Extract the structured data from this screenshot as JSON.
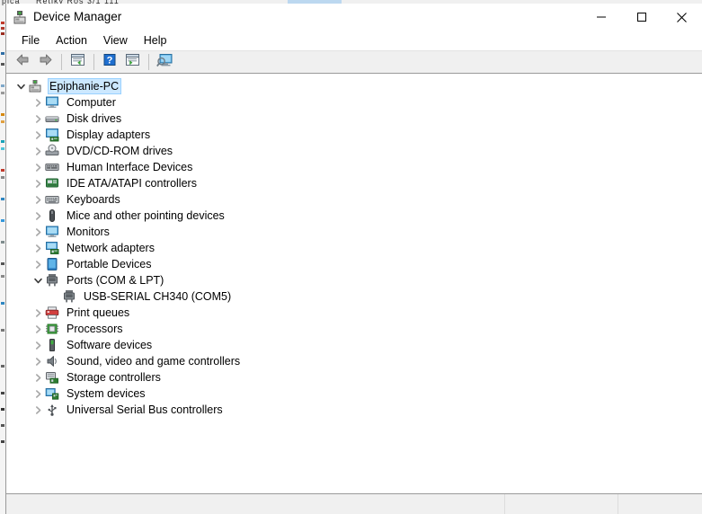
{
  "window": {
    "title": "Device Manager",
    "app_icon": "device-manager-icon",
    "controls": {
      "minimize": "–",
      "maximize": "□",
      "close": "✕"
    }
  },
  "menubar": {
    "items": [
      {
        "label": "File"
      },
      {
        "label": "Action"
      },
      {
        "label": "View"
      },
      {
        "label": "Help"
      }
    ]
  },
  "toolbar": {
    "buttons": [
      {
        "name": "back-button",
        "icon": "left-arrow-icon"
      },
      {
        "name": "forward-button",
        "icon": "right-arrow-icon"
      },
      {
        "name": "properties-button",
        "icon": "properties-icon"
      },
      {
        "name": "help-button",
        "icon": "question-mark-icon"
      },
      {
        "name": "update-driver-button",
        "icon": "play-window-icon"
      },
      {
        "name": "scan-hardware-changes-button",
        "icon": "monitor-search-icon"
      }
    ]
  },
  "tree": {
    "nodes": [
      {
        "label": "Epiphanie-PC",
        "level": 0,
        "expanded": true,
        "selected": true,
        "icon": "computer-root-icon",
        "has_children": true
      },
      {
        "label": "Computer",
        "level": 1,
        "expanded": false,
        "selected": false,
        "icon": "monitor-icon",
        "has_children": true
      },
      {
        "label": "Disk drives",
        "level": 1,
        "expanded": false,
        "selected": false,
        "icon": "disk-drive-icon",
        "has_children": true
      },
      {
        "label": "Display adapters",
        "level": 1,
        "expanded": false,
        "selected": false,
        "icon": "display-adapter-icon",
        "has_children": true
      },
      {
        "label": "DVD/CD-ROM drives",
        "level": 1,
        "expanded": false,
        "selected": false,
        "icon": "optical-drive-icon",
        "has_children": true
      },
      {
        "label": "Human Interface Devices",
        "level": 1,
        "expanded": false,
        "selected": false,
        "icon": "hid-icon",
        "has_children": true
      },
      {
        "label": "IDE ATA/ATAPI controllers",
        "level": 1,
        "expanded": false,
        "selected": false,
        "icon": "ide-controller-icon",
        "has_children": true
      },
      {
        "label": "Keyboards",
        "level": 1,
        "expanded": false,
        "selected": false,
        "icon": "keyboard-icon",
        "has_children": true
      },
      {
        "label": "Mice and other pointing devices",
        "level": 1,
        "expanded": false,
        "selected": false,
        "icon": "mouse-icon",
        "has_children": true
      },
      {
        "label": "Monitors",
        "level": 1,
        "expanded": false,
        "selected": false,
        "icon": "monitor-icon",
        "has_children": true
      },
      {
        "label": "Network adapters",
        "level": 1,
        "expanded": false,
        "selected": false,
        "icon": "network-adapter-icon",
        "has_children": true
      },
      {
        "label": "Portable Devices",
        "level": 1,
        "expanded": false,
        "selected": false,
        "icon": "portable-device-icon",
        "has_children": true
      },
      {
        "label": "Ports (COM & LPT)",
        "level": 1,
        "expanded": true,
        "selected": false,
        "icon": "port-icon",
        "has_children": true
      },
      {
        "label": "USB-SERIAL CH340 (COM5)",
        "level": 2,
        "expanded": false,
        "selected": false,
        "icon": "port-icon",
        "has_children": false
      },
      {
        "label": "Print queues",
        "level": 1,
        "expanded": false,
        "selected": false,
        "icon": "printer-icon",
        "has_children": true
      },
      {
        "label": "Processors",
        "level": 1,
        "expanded": false,
        "selected": false,
        "icon": "processor-icon",
        "has_children": true
      },
      {
        "label": "Software devices",
        "level": 1,
        "expanded": false,
        "selected": false,
        "icon": "software-device-icon",
        "has_children": true
      },
      {
        "label": "Sound, video and game controllers",
        "level": 1,
        "expanded": false,
        "selected": false,
        "icon": "speaker-icon",
        "has_children": true
      },
      {
        "label": "Storage controllers",
        "level": 1,
        "expanded": false,
        "selected": false,
        "icon": "storage-controller-icon",
        "has_children": true
      },
      {
        "label": "System devices",
        "level": 1,
        "expanded": false,
        "selected": false,
        "icon": "system-device-icon",
        "has_children": true
      },
      {
        "label": "Universal Serial Bus controllers",
        "level": 1,
        "expanded": false,
        "selected": false,
        "icon": "usb-icon",
        "has_children": true
      }
    ]
  },
  "statusbar": {
    "segment1": "",
    "segment2": "",
    "segment3": ""
  },
  "colors": {
    "selection": "#cce8ff",
    "selection_border": "#99d1ff",
    "chrome": "#f0f0f0",
    "border": "#9a9a9a"
  }
}
